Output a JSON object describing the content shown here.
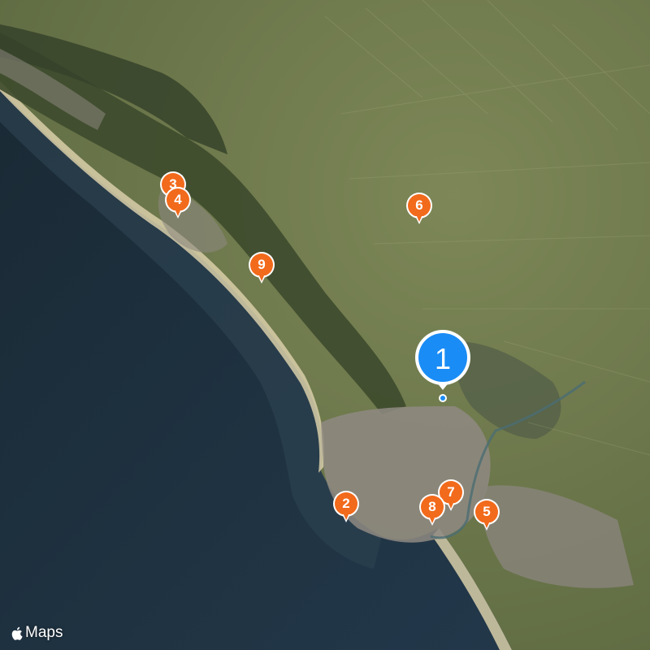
{
  "map": {
    "attribution": {
      "icon": "apple-logo-icon",
      "text": "Maps"
    },
    "colors": {
      "sea_deep": "#1c2c37",
      "sea_shallow": "#2c4150",
      "land": "#6f7a50",
      "forest": "#3d4a2c",
      "urban": "#8f8a82",
      "beach": "#d9cfa9",
      "marker_orange": "#f26a1b",
      "marker_blue": "#1a8cf5"
    },
    "selected_marker": {
      "label": "1",
      "color": "#1a8cf5"
    },
    "markers": [
      {
        "label": "2"
      },
      {
        "label": "3"
      },
      {
        "label": "4"
      },
      {
        "label": "5"
      },
      {
        "label": "6"
      },
      {
        "label": "7"
      },
      {
        "label": "8"
      },
      {
        "label": "9"
      }
    ]
  }
}
